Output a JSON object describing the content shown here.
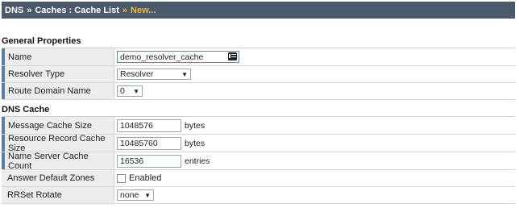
{
  "breadcrumb": {
    "items": [
      "DNS",
      "Caches : Cache List"
    ],
    "current": "New...",
    "separator": "»"
  },
  "general": {
    "title": "General Properties",
    "name_label": "Name",
    "name_value": "demo_resolver_cache",
    "resolver_type_label": "Resolver Type",
    "resolver_type_value": "Resolver",
    "route_domain_label": "Route Domain Name",
    "route_domain_value": "0"
  },
  "dns_cache": {
    "title": "DNS Cache",
    "message_cache_label": "Message Cache Size",
    "message_cache_value": "1048576",
    "message_cache_unit": "bytes",
    "rr_cache_label": "Resource Record Cache Size",
    "rr_cache_value": "10485760",
    "rr_cache_unit": "bytes",
    "ns_cache_label": "Name Server Cache Count",
    "ns_cache_value": "16536",
    "ns_cache_unit": "entries",
    "answer_default_label": "Answer Default Zones",
    "answer_default_option": "Enabled",
    "rrset_label": "RRSet Rotate",
    "rrset_value": "none"
  },
  "colors": {
    "topbar": "#4a5a6b",
    "accent": "#f2b637",
    "row_marker": "#5a7fa6"
  },
  "icons": {
    "name_field": "id-card-icon",
    "select": "chevron-down-icon"
  }
}
